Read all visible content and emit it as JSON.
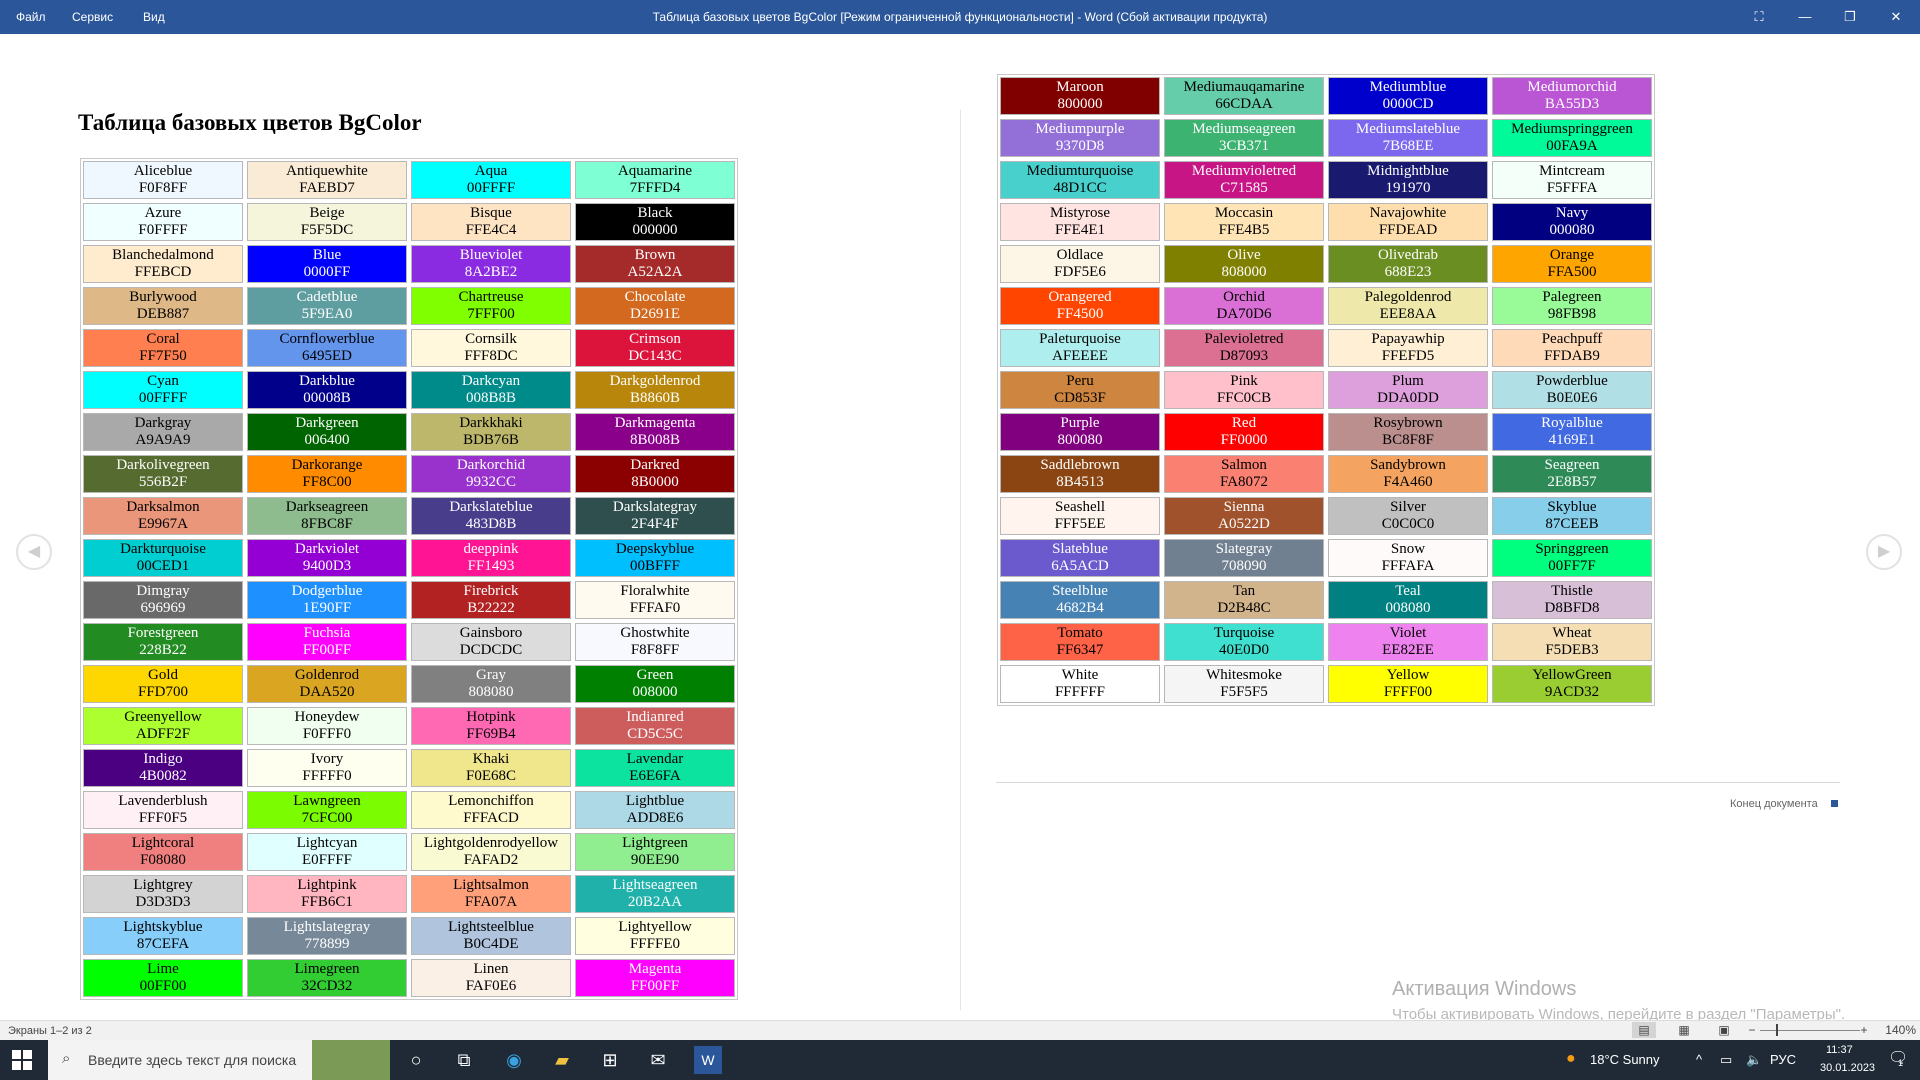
{
  "window": {
    "menu": [
      "Файл",
      "Сервис",
      "Вид"
    ],
    "title": "Таблица базовых цветов BgColor [Режим ограниченной функциональности] - Word (Сбой активации продукта)"
  },
  "document": {
    "heading": "Таблица базовых цветов BgColor",
    "end_label": "Конец документа",
    "colors_left": [
      [
        "Aliceblue",
        "F0F8FF",
        "#F0F8FF"
      ],
      [
        "Antiquewhite",
        "FAEBD7",
        "#FAEBD7"
      ],
      [
        "Aqua",
        "00FFFF",
        "#00FFFF"
      ],
      [
        "Aquamarine",
        "7FFFD4",
        "#7FFFD4"
      ],
      [
        "Azure",
        "F0FFFF",
        "#F0FFFF"
      ],
      [
        "Beige",
        "F5F5DC",
        "#F5F5DC"
      ],
      [
        "Bisque",
        "FFE4C4",
        "#FFE4C4"
      ],
      [
        "Black",
        "000000",
        "#000000"
      ],
      [
        "Blanchedalmond",
        "FFEBCD",
        "#FFEBCD"
      ],
      [
        "Blue",
        "0000FF",
        "#0000FF"
      ],
      [
        "Blueviolet",
        "8A2BE2",
        "#8A2BE2"
      ],
      [
        "Brown",
        "A52A2A",
        "#A52A2A"
      ],
      [
        "Burlywood",
        "DEB887",
        "#DEB887"
      ],
      [
        "Cadetblue",
        "5F9EA0",
        "#5F9EA0"
      ],
      [
        "Chartreuse",
        "7FFF00",
        "#7FFF00"
      ],
      [
        "Chocolate",
        "D2691E",
        "#D2691E"
      ],
      [
        "Coral",
        "FF7F50",
        "#FF7F50"
      ],
      [
        "Cornflowerblue",
        "6495ED",
        "#6495ED"
      ],
      [
        "Cornsilk",
        "FFF8DC",
        "#FFF8DC"
      ],
      [
        "Crimson",
        "DC143C",
        "#DC143C"
      ],
      [
        "Cyan",
        "00FFFF",
        "#00FFFF"
      ],
      [
        "Darkblue",
        "00008B",
        "#00008B"
      ],
      [
        "Darkcyan",
        "008B8B",
        "#008B8B"
      ],
      [
        "Darkgoldenrod",
        "B8860B",
        "#B8860B"
      ],
      [
        "Darkgray",
        "A9A9A9",
        "#A9A9A9"
      ],
      [
        "Darkgreen",
        "006400",
        "#006400"
      ],
      [
        "Darkkhaki",
        "BDB76B",
        "#BDB76B"
      ],
      [
        "Darkmagenta",
        "8B008B",
        "#8B008B"
      ],
      [
        "Darkolivegreen",
        "556B2F",
        "#556B2F"
      ],
      [
        "Darkorange",
        "FF8C00",
        "#FF8C00"
      ],
      [
        "Darkorchid",
        "9932CC",
        "#9932CC"
      ],
      [
        "Darkred",
        "8B0000",
        "#8B0000"
      ],
      [
        "Darksalmon",
        "E9967A",
        "#E9967A"
      ],
      [
        "Darkseagreen",
        "8FBC8F",
        "#8FBC8F"
      ],
      [
        "Darkslateblue",
        "483D8B",
        "#483D8B"
      ],
      [
        "Darkslategray",
        "2F4F4F",
        "#2F4F4F"
      ],
      [
        "Darkturquoise",
        "00CED1",
        "#00CED1"
      ],
      [
        "Darkviolet",
        "9400D3",
        "#9400D3"
      ],
      [
        "deeppink",
        "FF1493",
        "#FF1493"
      ],
      [
        "Deepskyblue",
        "00BFFF",
        "#00BFFF"
      ],
      [
        "Dimgray",
        "696969",
        "#696969"
      ],
      [
        "Dodgerblue",
        "1E90FF",
        "#1E90FF"
      ],
      [
        "Firebrick",
        "B22222",
        "#B22222"
      ],
      [
        "Floralwhite",
        "FFFAF0",
        "#FFFAF0"
      ],
      [
        "Forestgreen",
        "228B22",
        "#228B22"
      ],
      [
        "Fuchsia",
        "FF00FF",
        "#FF00FF"
      ],
      [
        "Gainsboro",
        "DCDCDC",
        "#DCDCDC"
      ],
      [
        "Ghostwhite",
        "F8F8FF",
        "#F8F8FF"
      ],
      [
        "Gold",
        "FFD700",
        "#FFD700"
      ],
      [
        "Goldenrod",
        "DAA520",
        "#DAA520"
      ],
      [
        "Gray",
        "808080",
        "#808080"
      ],
      [
        "Green",
        "008000",
        "#008000"
      ],
      [
        "Greenyellow",
        "ADFF2F",
        "#ADFF2F"
      ],
      [
        "Honeydew",
        "F0FFF0",
        "#F0FFF0"
      ],
      [
        "Hotpink",
        "FF69B4",
        "#FF69B4"
      ],
      [
        "Indianred",
        "CD5C5C",
        "#CD5C5C"
      ],
      [
        "Indigo",
        "4B0082",
        "#4B0082"
      ],
      [
        "Ivory",
        "FFFFF0",
        "#FFFFF0"
      ],
      [
        "Khaki",
        "F0E68C",
        "#F0E68C"
      ],
      [
        "Lavendar",
        "E6E6FA",
        "#0BE39F"
      ],
      [
        "Lavenderblush",
        "FFF0F5",
        "#FFF0F5"
      ],
      [
        "Lawngreen",
        "7CFC00",
        "#7CFC00"
      ],
      [
        "Lemonchiffon",
        "FFFACD",
        "#FFFACD"
      ],
      [
        "Lightblue",
        "ADD8E6",
        "#ADD8E6"
      ],
      [
        "Lightcoral",
        "F08080",
        "#F08080"
      ],
      [
        "Lightcyan",
        "E0FFFF",
        "#E0FFFF"
      ],
      [
        "Lightgoldenrodyellow",
        "FAFAD2",
        "#FAFAD2"
      ],
      [
        "Lightgreen",
        "90EE90",
        "#90EE90"
      ],
      [
        "Lightgrey",
        "D3D3D3",
        "#D3D3D3"
      ],
      [
        "Lightpink",
        "FFB6C1",
        "#FFB6C1"
      ],
      [
        "Lightsalmon",
        "FFA07A",
        "#FFA07A"
      ],
      [
        "Lightseagreen",
        "20B2AA",
        "#20B2AA"
      ],
      [
        "Lightskyblue",
        "87CEFA",
        "#87CEFA"
      ],
      [
        "Lightslategray",
        "778899",
        "#778899"
      ],
      [
        "Lightsteelblue",
        "B0C4DE",
        "#B0C4DE"
      ],
      [
        "Lightyellow",
        "FFFFE0",
        "#FFFFE0"
      ],
      [
        "Lime",
        "00FF00",
        "#00FF00"
      ],
      [
        "Limegreen",
        "32CD32",
        "#32CD32"
      ],
      [
        "Linen",
        "FAF0E6",
        "#FAF0E6"
      ],
      [
        "Magenta",
        "FF00FF",
        "#FF00FF"
      ]
    ],
    "colors_right": [
      [
        "Maroon",
        "800000",
        "#800000"
      ],
      [
        "Mediumauqamarine",
        "66CDAA",
        "#66CDAA"
      ],
      [
        "Mediumblue",
        "0000CD",
        "#0000CD"
      ],
      [
        "Mediumorchid",
        "BA55D3",
        "#BA55D3"
      ],
      [
        "Mediumpurple",
        "9370D8",
        "#9370D8"
      ],
      [
        "Mediumseagreen",
        "3CB371",
        "#3CB371"
      ],
      [
        "Mediumslateblue",
        "7B68EE",
        "#7B68EE"
      ],
      [
        "Mediumspringgreen",
        "00FA9A",
        "#00FA9A"
      ],
      [
        "Mediumturquoise",
        "48D1CC",
        "#48D1CC"
      ],
      [
        "Mediumvioletred",
        "C71585",
        "#C71585"
      ],
      [
        "Midnightblue",
        "191970",
        "#191970"
      ],
      [
        "Mintcream",
        "F5FFFA",
        "#F5FFFA"
      ],
      [
        "Mistyrose",
        "FFE4E1",
        "#FFE4E1"
      ],
      [
        "Moccasin",
        "FFE4B5",
        "#FFE4B5"
      ],
      [
        "Navajowhite",
        "FFDEAD",
        "#FFDEAD"
      ],
      [
        "Navy",
        "000080",
        "#000080"
      ],
      [
        "Oldlace",
        "FDF5E6",
        "#FDF5E6"
      ],
      [
        "Olive",
        "808000",
        "#808000"
      ],
      [
        "Olivedrab",
        "688E23",
        "#6B8E23"
      ],
      [
        "Orange",
        "FFA500",
        "#FFA500"
      ],
      [
        "Orangered",
        "FF4500",
        "#FF4500"
      ],
      [
        "Orchid",
        "DA70D6",
        "#DA70D6"
      ],
      [
        "Palegoldenrod",
        "EEE8AA",
        "#EEE8AA"
      ],
      [
        "Palegreen",
        "98FB98",
        "#98FB98"
      ],
      [
        "Paleturquoise",
        "AFEEEE",
        "#AFEEEE"
      ],
      [
        "Palevioletred",
        "D87093",
        "#DB7093"
      ],
      [
        "Papayawhip",
        "FFEFD5",
        "#FFEFD5"
      ],
      [
        "Peachpuff",
        "FFDAB9",
        "#FFDAB9"
      ],
      [
        "Peru",
        "CD853F",
        "#CD853F"
      ],
      [
        "Pink",
        "FFC0CB",
        "#FFC0CB"
      ],
      [
        "Plum",
        "DDA0DD",
        "#DDA0DD"
      ],
      [
        "Powderblue",
        "B0E0E6",
        "#B0E0E6"
      ],
      [
        "Purple",
        "800080",
        "#800080"
      ],
      [
        "Red",
        "FF0000",
        "#FF0000"
      ],
      [
        "Rosybrown",
        "BC8F8F",
        "#BC8F8F"
      ],
      [
        "Royalblue",
        "4169E1",
        "#4169E1"
      ],
      [
        "Saddlebrown",
        "8B4513",
        "#8B4513"
      ],
      [
        "Salmon",
        "FA8072",
        "#FA8072"
      ],
      [
        "Sandybrown",
        "F4A460",
        "#F4A460"
      ],
      [
        "Seagreen",
        "2E8B57",
        "#2E8B57"
      ],
      [
        "Seashell",
        "FFF5EE",
        "#FFF5EE"
      ],
      [
        "Sienna",
        "A0522D",
        "#A0522D"
      ],
      [
        "Silver",
        "C0C0C0",
        "#C0C0C0"
      ],
      [
        "Skyblue",
        "87CEEB",
        "#87CEEB"
      ],
      [
        "Slateblue",
        "6A5ACD",
        "#6A5ACD"
      ],
      [
        "Slategray",
        "708090",
        "#708090"
      ],
      [
        "Snow",
        "FFFAFA",
        "#FFFAFA"
      ],
      [
        "Springgreen",
        "00FF7F",
        "#00FF7F"
      ],
      [
        "Steelblue",
        "4682B4",
        "#4682B4"
      ],
      [
        "Tan",
        "D2B48C",
        "#D2B48C"
      ],
      [
        "Teal",
        "008080",
        "#008080"
      ],
      [
        "Thistle",
        "D8BFD8",
        "#D8BFD8"
      ],
      [
        "Tomato",
        "FF6347",
        "#FF6347"
      ],
      [
        "Turquoise",
        "40E0D0",
        "#40E0D0"
      ],
      [
        "Violet",
        "EE82EE",
        "#EE82EE"
      ],
      [
        "Wheat",
        "F5DEB3",
        "#F5DEB3"
      ],
      [
        "White",
        "FFFFFF",
        "#FFFFFF"
      ],
      [
        "Whitesmoke",
        "F5F5F5",
        "#F5F5F5"
      ],
      [
        "Yellow",
        "FFFF00",
        "#FFFF00"
      ],
      [
        "YellowGreen",
        "9ACD32",
        "#9ACD32"
      ]
    ]
  },
  "watermark": {
    "line1": "Активация Windows",
    "line2": "Чтобы активировать Windows, перейдите в раздел \"Параметры\"."
  },
  "statusbar": {
    "pages": "Экраны 1–2 из 2",
    "zoom": "140%"
  },
  "taskbar": {
    "search_placeholder": "Введите здесь текст для поиска",
    "weather": "18°C Sunny",
    "lang": "РУС",
    "time": "11:37",
    "date": "30.01.2023",
    "notif_count": "1"
  }
}
